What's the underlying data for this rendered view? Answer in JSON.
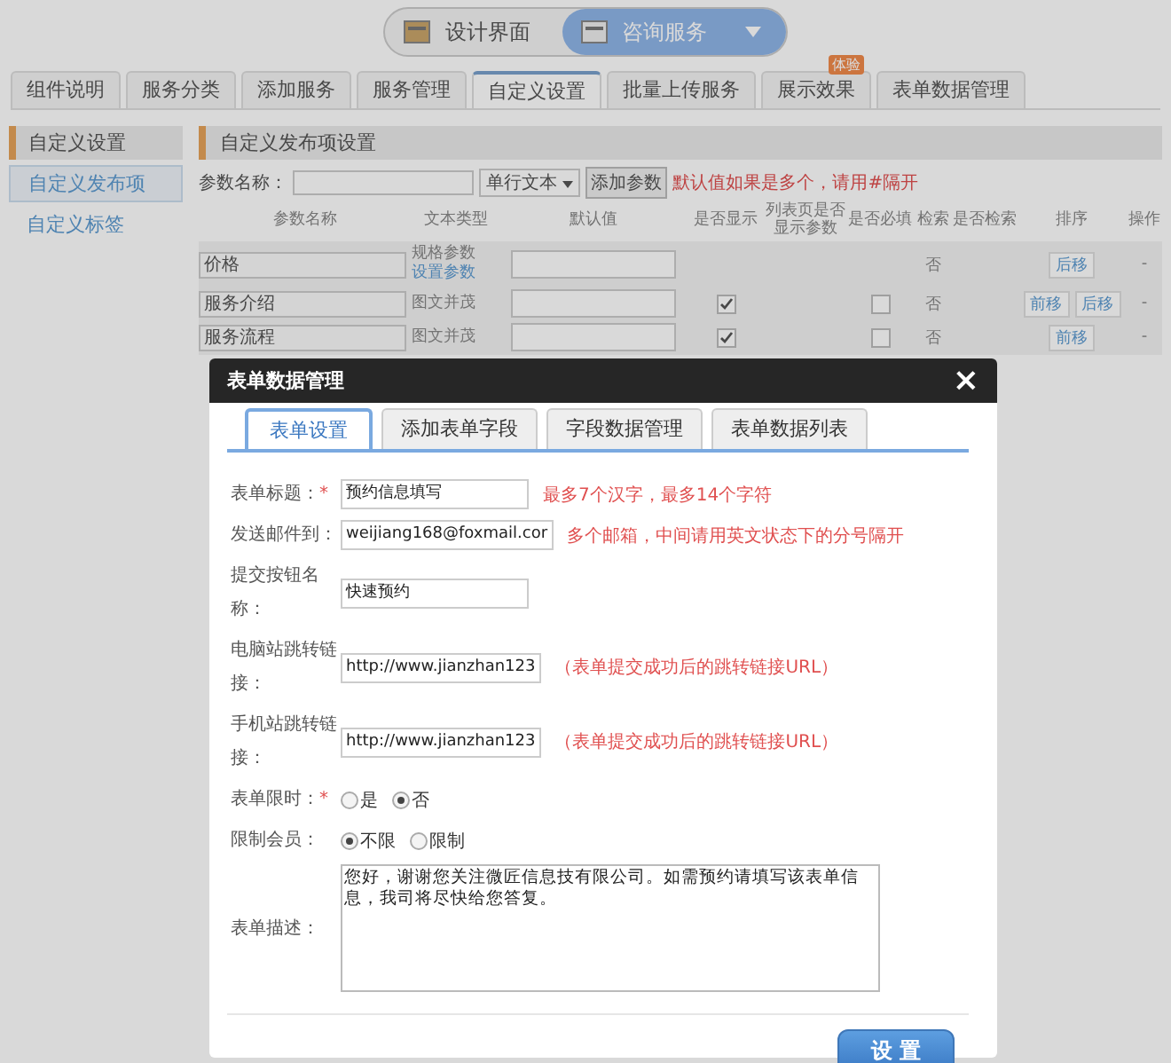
{
  "top_switch": [
    {
      "label": "设计界面",
      "selected": false
    },
    {
      "label": "咨询服务",
      "selected": true
    }
  ],
  "tabs": [
    {
      "label": "组件说明",
      "selected": false
    },
    {
      "label": "服务分类",
      "selected": false
    },
    {
      "label": "添加服务",
      "selected": false
    },
    {
      "label": "服务管理",
      "selected": false
    },
    {
      "label": "自定义设置",
      "selected": true
    },
    {
      "label": "批量上传服务",
      "selected": false
    },
    {
      "label": "展示效果",
      "selected": false,
      "badge": "体验"
    },
    {
      "label": "表单数据管理",
      "selected": false
    }
  ],
  "sidebar": {
    "title": "自定义设置",
    "items": [
      {
        "label": "自定义发布项",
        "selected": true
      },
      {
        "label": "自定义标签",
        "selected": false
      }
    ]
  },
  "panel": {
    "title": "自定义发布项设置",
    "param_label": "参数名称：",
    "type_select": "单行文本",
    "add_button": "添加参数",
    "hint": "默认值如果是多个，请用#隔开",
    "columns": [
      "参数名称",
      "文本类型",
      "默认值",
      "是否显示",
      "列表页是否显示参数",
      "是否必填",
      "检索",
      "是否检索",
      "排序",
      "操作"
    ],
    "rows": [
      {
        "name": "价格",
        "type": "规格参数",
        "type_link": "设置参数",
        "search": "否",
        "sort": [
          "后移"
        ],
        "op": "-"
      },
      {
        "name": "服务介绍",
        "type": "图文并茂",
        "show": true,
        "required": false,
        "search": "否",
        "sort": [
          "前移",
          "后移"
        ],
        "op": "-"
      },
      {
        "name": "服务流程",
        "type": "图文并茂",
        "show": true,
        "required": false,
        "search": "否",
        "sort": [
          "前移"
        ],
        "op": "-"
      }
    ]
  },
  "dialog": {
    "title": "表单数据管理",
    "close": "×",
    "tabs": [
      {
        "label": "表单设置",
        "selected": true
      },
      {
        "label": "添加表单字段",
        "selected": false
      },
      {
        "label": "字段数据管理",
        "selected": false
      },
      {
        "label": "表单数据列表",
        "selected": false
      }
    ],
    "fields": [
      {
        "kind": "input",
        "label": "表单标题：",
        "marker": "*",
        "value": "预约信息填写",
        "hint": "最多7个汉字，最多14个字符"
      },
      {
        "kind": "input",
        "label": "发送邮件到：",
        "value": "weijiang168@foxmail.cor",
        "hint": "多个邮箱，中间请用英文状态下的分号隔开"
      },
      {
        "kind": "input",
        "label": "提交按钮名称：",
        "value": "快速预约"
      },
      {
        "kind": "input",
        "label": "电脑站跳转链接：",
        "value": "http://www.jianzhan123",
        "hint": "（表单提交成功后的跳转链接URL）"
      },
      {
        "kind": "input",
        "label": "手机站跳转链接：",
        "value": "http://www.jianzhan123",
        "hint": "（表单提交成功后的跳转链接URL）"
      },
      {
        "kind": "radio",
        "label": "表单限时：",
        "marker": "*",
        "options": [
          {
            "label": "是",
            "selected": false
          },
          {
            "label": "否",
            "selected": true
          }
        ]
      },
      {
        "kind": "radio",
        "label": "限制会员：",
        "options": [
          {
            "label": "不限",
            "selected": true
          },
          {
            "label": "限制",
            "selected": false
          }
        ]
      },
      {
        "kind": "textarea",
        "label": "表单描述：",
        "value": "您好，谢谢您关注微匠信息技有限公司。如需预约请填写该表单信息，我司将尽快给您答复。"
      }
    ],
    "submit": "设 置"
  }
}
